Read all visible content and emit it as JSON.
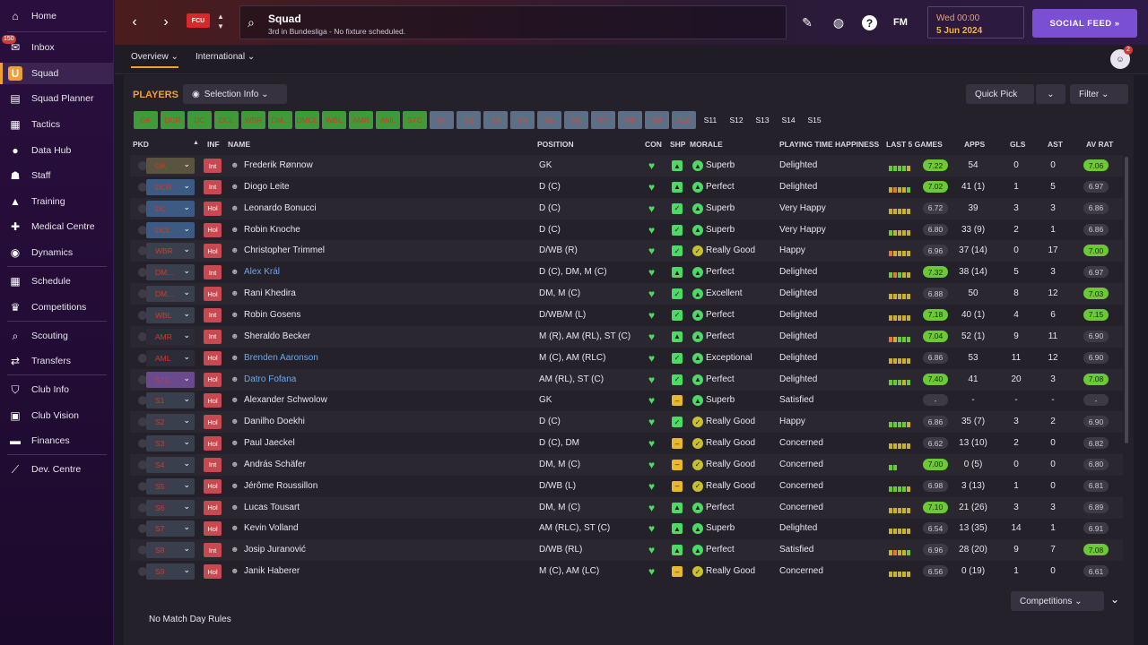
{
  "sidebar": {
    "items": [
      {
        "label": "Home",
        "icon": "home-icon",
        "glyph": "⌂"
      },
      {
        "label": "Inbox",
        "icon": "inbox-icon",
        "glyph": "✉",
        "badge": "150"
      },
      {
        "label": "Squad",
        "icon": "squad-icon",
        "glyph": "U",
        "active": true
      },
      {
        "label": "Squad Planner",
        "icon": "planner-icon",
        "glyph": "▤"
      },
      {
        "label": "Tactics",
        "icon": "tactics-icon",
        "glyph": "▦"
      },
      {
        "label": "Data Hub",
        "icon": "data-hub-icon",
        "glyph": "●"
      },
      {
        "label": "Staff",
        "icon": "staff-icon",
        "glyph": "☗"
      },
      {
        "label": "Training",
        "icon": "training-icon",
        "glyph": "▲"
      },
      {
        "label": "Medical Centre",
        "icon": "medical-icon",
        "glyph": "✚"
      },
      {
        "label": "Dynamics",
        "icon": "dynamics-icon",
        "glyph": "◉"
      },
      {
        "label": "Schedule",
        "icon": "schedule-icon",
        "glyph": "▦"
      },
      {
        "label": "Competitions",
        "icon": "trophy-icon",
        "glyph": "♛"
      },
      {
        "label": "Scouting",
        "icon": "scouting-icon",
        "glyph": "⌕"
      },
      {
        "label": "Transfers",
        "icon": "transfers-icon",
        "glyph": "⇄"
      },
      {
        "label": "Club Info",
        "icon": "shield-icon",
        "glyph": "⛉"
      },
      {
        "label": "Club Vision",
        "icon": "vision-icon",
        "glyph": "▣"
      },
      {
        "label": "Finances",
        "icon": "finances-icon",
        "glyph": "▬"
      },
      {
        "label": "Dev. Centre",
        "icon": "dev-centre-icon",
        "glyph": "⟋"
      }
    ]
  },
  "header": {
    "title": "Squad",
    "subtitle": "3rd in Bundesliga - No fixture scheduled.",
    "club_badge_text": "FCU",
    "date_line1": "Wed 00:00",
    "date_line2": "5 Jun 2024",
    "social_label": "SOCIAL FEED  »",
    "fm_label": "FM",
    "help_label": "?"
  },
  "subtabs": {
    "overview": "Overview ⌄",
    "international": "International ⌄",
    "notif_badge": "2"
  },
  "toolbar": {
    "players_label": "PLAYERS",
    "selection_info": "Selection Info  ⌄",
    "quick_pick": "Quick Pick",
    "filter": "Filter  ⌄",
    "competitions": "Competitions  ⌄"
  },
  "chips": [
    {
      "t": "GK",
      "c": "g"
    },
    {
      "t": "DCR",
      "c": "g"
    },
    {
      "t": "DC",
      "c": "g"
    },
    {
      "t": "DCL",
      "c": "g"
    },
    {
      "t": "WBR",
      "c": "g"
    },
    {
      "t": "DM...",
      "c": "g"
    },
    {
      "t": "DMCL",
      "c": "g"
    },
    {
      "t": "WBL",
      "c": "g"
    },
    {
      "t": "AMR",
      "c": "g"
    },
    {
      "t": "AML",
      "c": "g"
    },
    {
      "t": "STC",
      "c": "g"
    },
    {
      "t": "S1",
      "c": "b"
    },
    {
      "t": "S2",
      "c": "b"
    },
    {
      "t": "S3",
      "c": "b"
    },
    {
      "t": "S4",
      "c": "b"
    },
    {
      "t": "S5",
      "c": "b"
    },
    {
      "t": "S6",
      "c": "b"
    },
    {
      "t": "S7",
      "c": "b"
    },
    {
      "t": "S8",
      "c": "b"
    },
    {
      "t": "S9",
      "c": "b"
    },
    {
      "t": "S10",
      "c": "b"
    },
    {
      "t": "S11",
      "c": "d"
    },
    {
      "t": "S12",
      "c": "d"
    },
    {
      "t": "S13",
      "c": "d"
    },
    {
      "t": "S14",
      "c": "d"
    },
    {
      "t": "S15",
      "c": "d"
    }
  ],
  "table": {
    "headers": {
      "pkd": "PKD",
      "inf": "INF",
      "name": "NAME",
      "position": "POSITION",
      "con": "CON",
      "shp": "SHP",
      "morale": "MORALE",
      "pth": "PLAYING TIME HAPPINESS",
      "l5": "LAST 5 GAMES",
      "apps": "APPS",
      "gls": "GLS",
      "ast": "AST",
      "avrat": "AV RAT"
    },
    "rows": [
      {
        "sel": "GK",
        "selc": "#5a5340",
        "inf": "Int",
        "name": "Frederik Rønnow",
        "pos": "GK",
        "shp": "up",
        "mor": "Superb",
        "pth": "Delighted",
        "l5": "ggggy",
        "form": "7.22",
        "formg": true,
        "apps": "54",
        "gls": "0",
        "ast": "0",
        "av": "7.06",
        "avg": true
      },
      {
        "sel": "DCR",
        "selc": "#3d5a82",
        "inf": "Int",
        "name": "Diogo Leite",
        "pos": "D (C)",
        "shp": "up",
        "mor": "Perfect",
        "pth": "Delighted",
        "l5": "yoyyg",
        "form": "7.02",
        "formg": true,
        "apps": "41 (1)",
        "gls": "1",
        "ast": "5",
        "av": "6.97",
        "avg": false
      },
      {
        "sel": "DC",
        "selc": "#3d5a82",
        "inf": "Hol",
        "name": "Leonardo Bonucci",
        "pos": "D (C)",
        "shp": "ok",
        "mor": "Superb",
        "pth": "Very Happy",
        "l5": "yyyyy",
        "form": "6.72",
        "formg": false,
        "apps": "39",
        "gls": "3",
        "ast": "3",
        "av": "6.86",
        "avg": false
      },
      {
        "sel": "DCL",
        "selc": "#3d5a82",
        "inf": "Hol",
        "name": "Robin Knoche",
        "pos": "D (C)",
        "shp": "ok",
        "mor": "Superb",
        "pth": "Very Happy",
        "l5": "gyyyy",
        "form": "6.80",
        "formg": false,
        "apps": "33 (9)",
        "gls": "2",
        "ast": "1",
        "av": "6.86",
        "avg": false
      },
      {
        "sel": "WBR",
        "selc": "#3a3f4e",
        "inf": "Hol",
        "name": "Christopher Trimmel",
        "pos": "D/WB (R)",
        "shp": "ok",
        "mor": "Really Good",
        "pth": "Happy",
        "l5": "oyyyy",
        "form": "6.96",
        "formg": false,
        "apps": "37 (14)",
        "gls": "0",
        "ast": "17",
        "av": "7.00",
        "avg": true
      },
      {
        "sel": "DM...",
        "selc": "#3a3f4e",
        "inf": "Int",
        "name": "Alex Král",
        "blue": true,
        "pos": "D (C), DM, M (C)",
        "shp": "up",
        "mor": "Perfect",
        "pth": "Delighted",
        "l5": "gogyy",
        "form": "7.32",
        "formg": true,
        "apps": "38 (14)",
        "gls": "5",
        "ast": "3",
        "av": "6.97",
        "avg": false
      },
      {
        "sel": "DM...",
        "selc": "#3a3f4e",
        "inf": "Hol",
        "name": "Rani Khedira",
        "pos": "DM, M (C)",
        "shp": "ok",
        "mor": "Excellent",
        "pth": "Delighted",
        "l5": "yyyyy",
        "form": "6.88",
        "formg": false,
        "apps": "50",
        "gls": "8",
        "ast": "12",
        "av": "7.03",
        "avg": true
      },
      {
        "sel": "WBL",
        "selc": "#3a3f4e",
        "inf": "Int",
        "name": "Robin Gosens",
        "pos": "D/WB/M (L)",
        "shp": "ok",
        "mor": "Perfect",
        "pth": "Delighted",
        "l5": "yyyyy",
        "form": "7.18",
        "formg": true,
        "apps": "40 (1)",
        "gls": "4",
        "ast": "6",
        "av": "7.15",
        "avg": true
      },
      {
        "sel": "AMR",
        "selc": "#2b2c38",
        "inf": "Int",
        "name": "Sheraldo Becker",
        "pos": "M (R), AM (RL), ST (C)",
        "shp": "up",
        "mor": "Perfect",
        "pth": "Delighted",
        "l5": "oyggg",
        "form": "7.04",
        "formg": true,
        "apps": "52 (1)",
        "gls": "9",
        "ast": "11",
        "av": "6.90",
        "avg": false
      },
      {
        "sel": "AML",
        "selc": "#2b2c38",
        "inf": "Hol",
        "name": "Brenden Aaronson",
        "blue": true,
        "pos": "M (C), AM (RLC)",
        "shp": "ok",
        "mor": "Exceptional",
        "pth": "Delighted",
        "l5": "yyyyy",
        "form": "6.86",
        "formg": false,
        "apps": "53",
        "gls": "11",
        "ast": "12",
        "av": "6.90",
        "avg": false
      },
      {
        "sel": "STC",
        "selc": "#6a4a8c",
        "inf": "Hol",
        "name": "Datro Fofana",
        "blue": true,
        "pos": "AM (RL), ST (C)",
        "shp": "ok",
        "mor": "Perfect",
        "pth": "Delighted",
        "l5": "gggyg",
        "form": "7.40",
        "formg": true,
        "apps": "41",
        "gls": "20",
        "ast": "3",
        "av": "7.08",
        "avg": true
      },
      {
        "sel": "S1",
        "selc": "#3a3f4e",
        "inf": "Hol",
        "name": "Alexander Schwolow",
        "pos": "GK",
        "shp": "mid",
        "mor": "Superb",
        "pth": "Satisfied",
        "l5": "",
        "form": "-",
        "formg": false,
        "apps": "-",
        "gls": "-",
        "ast": "-",
        "av": "-",
        "avg": false
      },
      {
        "sel": "S2",
        "selc": "#3a3f4e",
        "inf": "Hol",
        "name": "Danilho Doekhi",
        "pos": "D (C)",
        "shp": "ok",
        "mor": "Really Good",
        "pth": "Happy",
        "l5": "ggggy",
        "form": "6.86",
        "formg": false,
        "apps": "35 (7)",
        "gls": "3",
        "ast": "2",
        "av": "6.90",
        "avg": false
      },
      {
        "sel": "S3",
        "selc": "#3a3f4e",
        "inf": "Hol",
        "name": "Paul Jaeckel",
        "pos": "D (C), DM",
        "shp": "mid",
        "mor": "Really Good",
        "pth": "Concerned",
        "l5": "yyyyy",
        "form": "6.62",
        "formg": false,
        "apps": "13 (10)",
        "gls": "2",
        "ast": "0",
        "av": "6.82",
        "avg": false
      },
      {
        "sel": "S4",
        "selc": "#3a3f4e",
        "inf": "Int",
        "name": "András Schäfer",
        "pos": "DM, M (C)",
        "shp": "mid",
        "mor": "Really Good",
        "pth": "Concerned",
        "l5": "gg",
        "form": "7.00",
        "formg": true,
        "apps": "0 (5)",
        "gls": "0",
        "ast": "0",
        "av": "6.80",
        "avg": false
      },
      {
        "sel": "S5",
        "selc": "#3a3f4e",
        "inf": "Hol",
        "name": "Jérôme Roussillon",
        "pos": "D/WB (L)",
        "shp": "mid",
        "mor": "Really Good",
        "pth": "Concerned",
        "l5": "ggggy",
        "form": "6.98",
        "formg": false,
        "apps": "3 (13)",
        "gls": "1",
        "ast": "0",
        "av": "6.81",
        "avg": false
      },
      {
        "sel": "S6",
        "selc": "#3a3f4e",
        "inf": "Hol",
        "name": "Lucas Tousart",
        "pos": "DM, M (C)",
        "shp": "up",
        "mor": "Perfect",
        "pth": "Concerned",
        "l5": "yyyyy",
        "form": "7.10",
        "formg": true,
        "apps": "21 (26)",
        "gls": "3",
        "ast": "3",
        "av": "6.89",
        "avg": false
      },
      {
        "sel": "S7",
        "selc": "#3a3f4e",
        "inf": "Hol",
        "name": "Kevin Volland",
        "pos": "AM (RLC), ST (C)",
        "shp": "up",
        "mor": "Superb",
        "pth": "Delighted",
        "l5": "yyyyy",
        "form": "6.54",
        "formg": false,
        "apps": "13 (35)",
        "gls": "14",
        "ast": "1",
        "av": "6.91",
        "avg": false
      },
      {
        "sel": "S8",
        "selc": "#3a3f4e",
        "inf": "Int",
        "name": "Josip Juranović",
        "pos": "D/WB (RL)",
        "shp": "up",
        "mor": "Perfect",
        "pth": "Satisfied",
        "l5": "yoyyg",
        "form": "6.96",
        "formg": false,
        "apps": "28 (20)",
        "gls": "9",
        "ast": "7",
        "av": "7.08",
        "avg": true
      },
      {
        "sel": "S9",
        "selc": "#3a3f4e",
        "inf": "Hol",
        "name": "Janik Haberer",
        "pos": "M (C), AM (LC)",
        "shp": "mid",
        "mor": "Really Good",
        "pth": "Concerned",
        "l5": "yyyyy",
        "form": "6.56",
        "formg": false,
        "apps": "0 (19)",
        "gls": "1",
        "ast": "0",
        "av": "6.61",
        "avg": false
      }
    ]
  },
  "footer": {
    "rules": "No Match Day Rules"
  },
  "colors": {
    "accent": "#f0a030",
    "social": "#7b4fd3",
    "green": "#6bc936"
  }
}
